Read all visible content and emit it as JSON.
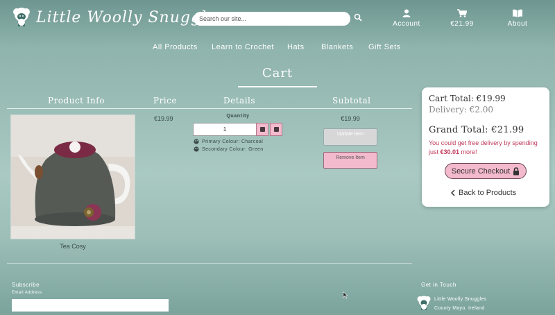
{
  "header": {
    "site_title": "Little Woolly Snuggles",
    "search_placeholder": "Search our site...",
    "account_label": "Account",
    "cart_amount": "€21.99",
    "about_label": "About"
  },
  "nav": {
    "items": [
      "All Products",
      "Learn to Crochet",
      "Hats",
      "Blankets",
      "Gift Sets"
    ]
  },
  "cart": {
    "title": "Cart",
    "columns": [
      "Product Info",
      "Price",
      "Details",
      "Subtotal"
    ],
    "item": {
      "name": "Tea Cosy",
      "price": "€19.99",
      "quantity_label": "Quantity",
      "quantity": "1",
      "primary_colour": "Primary Colour: Charcoal",
      "secondary_colour": "Secondary Colour: Green",
      "subtotal": "€19.99",
      "update_label": "Update Item",
      "remove_label": "Remove Item"
    }
  },
  "summary": {
    "cart_total": "Cart Total: €19.99",
    "delivery": "Delivery: €2.00",
    "grand_total": "Grand Total: €21.99",
    "free_delivery_prefix": "You could get free delivery by spending just ",
    "free_delivery_amount": "€30.01",
    "free_delivery_suffix": " more!",
    "checkout_label": "Secure Checkout",
    "back_label": "Back to Products"
  },
  "footer": {
    "subscribe_heading": "Subscribe",
    "email_label": "Email Address",
    "get_in_touch": "Get in Touch",
    "business_name": "Little Woolly Snuggles",
    "address": "County Mayo, Ireland"
  },
  "icons": {
    "logo": "sheep-logo-icon",
    "search": "search-icon",
    "account": "user-icon",
    "cart": "cart-icon",
    "about": "book-icon",
    "minus": "minus-icon",
    "plus": "plus-icon",
    "colour": "palette-icon",
    "lock": "lock-icon",
    "back": "chevron-left-icon"
  },
  "colors": {
    "accent_pink": "#f3b9cc",
    "alert_red": "#c03a5a",
    "background_teal": "#8fb3ad"
  }
}
